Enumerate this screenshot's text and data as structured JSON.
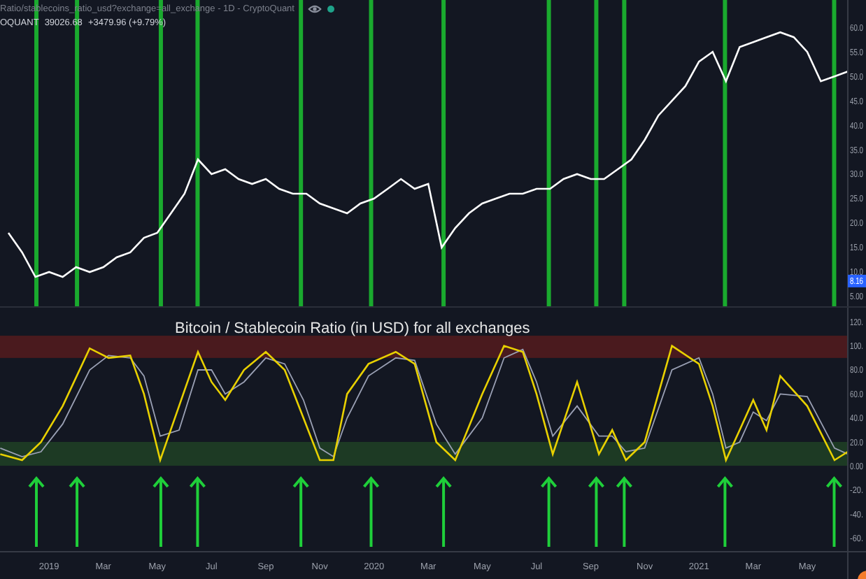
{
  "legend": {
    "title": "Ratio/stablecoins_ratio_usd?exchange=all_exchange - 1D - CryptoQuant",
    "symbol": "OQUANT",
    "value": "39026.68",
    "change": "+3479.96 (+9.79%)"
  },
  "price_chart": {
    "chart_data": {
      "type": "line",
      "ref_lines": [
        {
          "axis": "x",
          "value": 2018.961
        },
        {
          "axis": "x",
          "value": 2019.086
        },
        {
          "axis": "x",
          "value": 2019.344
        },
        {
          "axis": "x",
          "value": 2019.457
        },
        {
          "axis": "x",
          "value": 2019.775
        },
        {
          "axis": "x",
          "value": 2019.991
        },
        {
          "axis": "x",
          "value": 2020.214
        },
        {
          "axis": "x",
          "value": 2020.538
        },
        {
          "axis": "x",
          "value": 2020.684
        },
        {
          "axis": "x",
          "value": 2020.77
        },
        {
          "axis": "x",
          "value": 2021.08
        },
        {
          "axis": "x",
          "value": 2021.416
        }
      ],
      "x": [
        2018.875,
        2018.917,
        2018.958,
        2019,
        2019.042,
        2019.083,
        2019.125,
        2019.167,
        2019.208,
        2019.25,
        2019.292,
        2019.333,
        2019.375,
        2019.417,
        2019.458,
        2019.5,
        2019.542,
        2019.583,
        2019.625,
        2019.667,
        2019.708,
        2019.75,
        2019.792,
        2019.833,
        2019.875,
        2019.917,
        2019.958,
        2020,
        2020.042,
        2020.083,
        2020.125,
        2020.167,
        2020.208,
        2020.25,
        2020.292,
        2020.333,
        2020.375,
        2020.417,
        2020.458,
        2020.5,
        2020.542,
        2020.583,
        2020.625,
        2020.667,
        2020.708,
        2020.75,
        2020.792,
        2020.833,
        2020.875,
        2020.917,
        2020.958,
        2021,
        2021.042,
        2021.083,
        2021.125,
        2021.167,
        2021.208,
        2021.25,
        2021.292,
        2021.333,
        2021.375,
        2021.417,
        2021.458
      ],
      "series": [
        {
          "color": "#ffffff",
          "values": [
            18,
            14,
            9,
            10,
            9,
            11,
            10,
            11,
            13,
            14,
            17,
            18,
            22,
            26,
            33,
            30,
            31,
            29,
            28,
            29,
            27,
            26,
            26,
            24,
            23,
            22,
            24,
            25,
            27,
            29,
            27,
            28,
            15,
            19,
            22,
            24,
            25,
            26,
            26,
            27,
            27,
            29,
            30,
            29,
            29,
            31,
            33,
            37,
            42,
            45,
            48,
            53,
            55,
            49,
            56,
            57,
            58,
            59,
            58,
            55,
            49,
            50,
            51
          ]
        }
      ],
      "xlim": [
        2018.849,
        2021.458
      ],
      "ylim": [
        3,
        65.6
      ],
      "yticks": [
        {
          "value": 60,
          "label": "60.0"
        },
        {
          "value": 55,
          "label": "55.0"
        },
        {
          "value": 50,
          "label": "50.0"
        },
        {
          "value": 45,
          "label": "45.0"
        },
        {
          "value": 40,
          "label": "40.0"
        },
        {
          "value": 35,
          "label": "35.0"
        },
        {
          "value": 30,
          "label": "30.0"
        },
        {
          "value": 25,
          "label": "25.0"
        },
        {
          "value": 20,
          "label": "20.0"
        },
        {
          "value": 15,
          "label": "15.0"
        },
        {
          "value": 10,
          "label": "10.0"
        },
        {
          "value": 5,
          "label": "5.00"
        }
      ]
    },
    "last_price": {
      "label": "8.16"
    }
  },
  "ratio_chart": {
    "chart_data": {
      "type": "line",
      "title": "Bitcoin / Stablecoin Ratio (in USD) for all exchanges",
      "x": [
        2018.85,
        2018.917,
        2018.975,
        2019.042,
        2019.125,
        2019.183,
        2019.25,
        2019.292,
        2019.342,
        2019.4,
        2019.458,
        2019.5,
        2019.542,
        2019.6,
        2019.667,
        2019.725,
        2019.783,
        2019.833,
        2019.875,
        2019.917,
        2019.983,
        2020.067,
        2020.125,
        2020.192,
        2020.25,
        2020.333,
        2020.4,
        2020.458,
        2020.5,
        2020.55,
        2020.625,
        2020.692,
        2020.733,
        2020.775,
        2020.833,
        2020.917,
        2021,
        2021.042,
        2021.083,
        2021.125,
        2021.167,
        2021.208,
        2021.25,
        2021.333,
        2021.417,
        2021.458
      ],
      "series": [
        {
          "color": "#e8d000",
          "values": [
            10,
            5,
            20,
            50,
            98,
            90,
            92,
            60,
            5,
            50,
            95,
            70,
            55,
            80,
            95,
            80,
            40,
            5,
            5,
            60,
            85,
            95,
            85,
            20,
            5,
            60,
            100,
            95,
            60,
            10,
            70,
            10,
            30,
            5,
            20,
            100,
            85,
            50,
            5,
            30,
            55,
            30,
            75,
            50,
            5,
            12
          ]
        },
        {
          "color": "#9aa0b4",
          "values": [
            15,
            8,
            12,
            35,
            80,
            92,
            90,
            75,
            25,
            30,
            80,
            80,
            60,
            70,
            90,
            85,
            55,
            15,
            8,
            40,
            75,
            90,
            88,
            35,
            10,
            40,
            90,
            97,
            70,
            25,
            50,
            25,
            25,
            12,
            15,
            80,
            90,
            60,
            15,
            20,
            45,
            38,
            60,
            58,
            15,
            10
          ]
        }
      ],
      "bands": [
        {
          "axis": "y",
          "from": 90,
          "to": 108.5,
          "color": "#4a1a1e"
        },
        {
          "axis": "y",
          "from": 0.4,
          "to": 20.2,
          "color": "#1d3a24"
        }
      ],
      "xlim": [
        2018.849,
        2021.458
      ],
      "ylim": [
        -93.8,
        131.8
      ],
      "xticks": [
        {
          "value": 2019,
          "label": "2019"
        },
        {
          "value": 2019.167,
          "label": "Mar"
        },
        {
          "value": 2019.333,
          "label": "May"
        },
        {
          "value": 2019.5,
          "label": "Jul"
        },
        {
          "value": 2019.667,
          "label": "Sep"
        },
        {
          "value": 2019.833,
          "label": "Nov"
        },
        {
          "value": 2020,
          "label": "2020"
        },
        {
          "value": 2020.167,
          "label": "Mar"
        },
        {
          "value": 2020.333,
          "label": "May"
        },
        {
          "value": 2020.5,
          "label": "Jul"
        },
        {
          "value": 2020.667,
          "label": "Sep"
        },
        {
          "value": 2020.833,
          "label": "Nov"
        },
        {
          "value": 2021,
          "label": "2021"
        },
        {
          "value": 2021.167,
          "label": "Mar"
        },
        {
          "value": 2021.333,
          "label": "May"
        }
      ],
      "yticks": [
        {
          "value": 120,
          "label": "120."
        },
        {
          "value": 100,
          "label": "100."
        },
        {
          "value": 80,
          "label": "80.0"
        },
        {
          "value": 60,
          "label": "60.0"
        },
        {
          "value": 40,
          "label": "40.0"
        },
        {
          "value": 20,
          "label": "20.0"
        },
        {
          "value": 0,
          "label": "0.00"
        },
        {
          "value": -20,
          "label": "-20."
        },
        {
          "value": -40,
          "label": "-40."
        },
        {
          "value": -60,
          "label": "-60."
        }
      ]
    }
  }
}
